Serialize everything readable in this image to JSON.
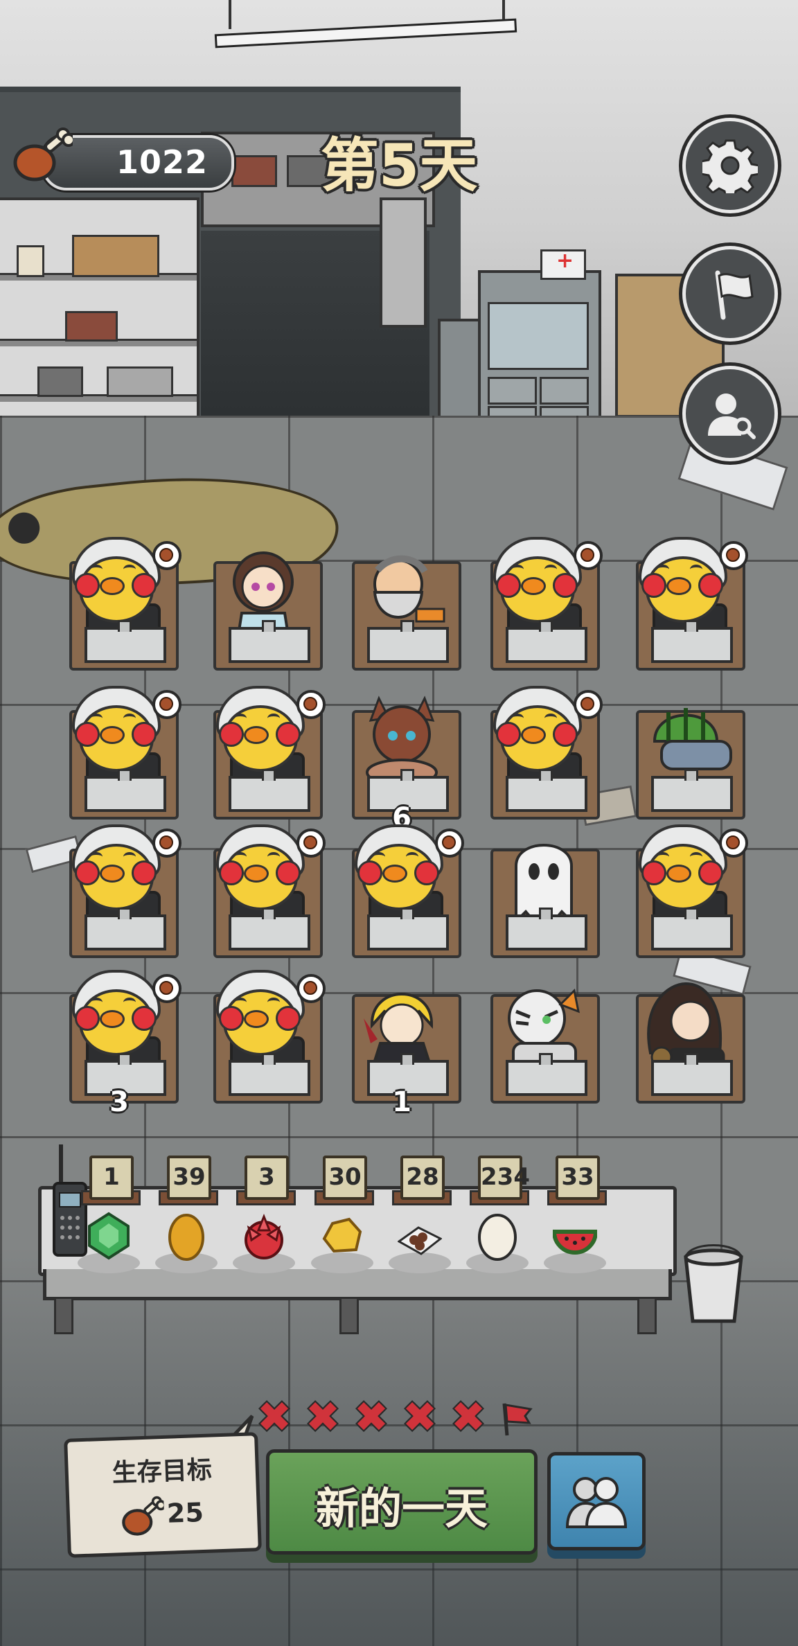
{
  "hud": {
    "food": "1022",
    "day_title": "第5天"
  },
  "seats": [
    {
      "char": "student",
      "badge": true,
      "count": ""
    },
    {
      "char": "braided-girl",
      "badge": false,
      "count": ""
    },
    {
      "char": "old-miner",
      "badge": false,
      "count": ""
    },
    {
      "char": "student",
      "badge": true,
      "count": ""
    },
    {
      "char": "student",
      "badge": true,
      "count": ""
    },
    {
      "char": "student",
      "badge": true,
      "count": ""
    },
    {
      "char": "student",
      "badge": true,
      "count": ""
    },
    {
      "char": "horned-beast",
      "badge": false,
      "count": "6"
    },
    {
      "char": "student",
      "badge": true,
      "count": ""
    },
    {
      "char": "melon-helmet",
      "badge": false,
      "count": ""
    },
    {
      "char": "student",
      "badge": true,
      "count": ""
    },
    {
      "char": "student",
      "badge": true,
      "count": ""
    },
    {
      "char": "student",
      "badge": true,
      "count": ""
    },
    {
      "char": "ghost",
      "badge": false,
      "count": ""
    },
    {
      "char": "student",
      "badge": true,
      "count": ""
    },
    {
      "char": "student",
      "badge": true,
      "count": "3"
    },
    {
      "char": "student",
      "badge": true,
      "count": ""
    },
    {
      "char": "blonde-vampire",
      "badge": false,
      "count": "1"
    },
    {
      "char": "white-tiger",
      "badge": false,
      "count": ""
    },
    {
      "char": "dark-hair-girl",
      "badge": false,
      "count": ""
    }
  ],
  "items": [
    {
      "name": "emerald-icon",
      "count": "1",
      "color": "#3fae5a"
    },
    {
      "name": "golden-egg-icon",
      "count": "39",
      "color": "#e3a426"
    },
    {
      "name": "dragonfruit-icon",
      "count": "3",
      "color": "#d9343d"
    },
    {
      "name": "gold-nugget-icon",
      "count": "30",
      "color": "#f0c53b"
    },
    {
      "name": "chocolate-plate-icon",
      "count": "28",
      "color": "#6b3a26"
    },
    {
      "name": "egg-icon",
      "count": "234",
      "color": "#f3eee2"
    },
    {
      "name": "watermelon-icon",
      "count": "33",
      "color": "#d8323a"
    }
  ],
  "bottom": {
    "strikes": [
      "✖",
      "✖",
      "✖",
      "✖",
      "✖"
    ],
    "goal_title": "生存目标",
    "goal_amount": "25",
    "new_day_label": "新的一天"
  },
  "colors": {
    "accent_green": "#5a9650",
    "accent_blue": "#4a92bd",
    "strike_red": "#d0333b",
    "title_cream": "#f6e6b8"
  }
}
